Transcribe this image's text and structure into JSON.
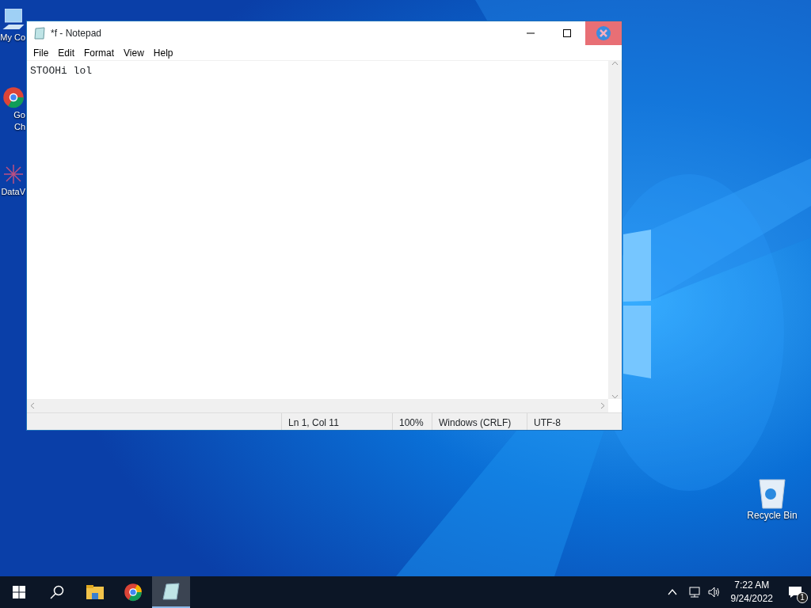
{
  "desktop_icons": [
    {
      "kind": "computer",
      "lines": [
        "My Co"
      ]
    },
    {
      "kind": "browser",
      "lines": [
        "Go",
        "Ch"
      ]
    },
    {
      "kind": "app",
      "lines": [
        "DataV"
      ]
    },
    {
      "kind": "recycle",
      "lines": [
        "Recycle Bin"
      ]
    }
  ],
  "window": {
    "title": "*f - Notepad",
    "menu": [
      "File",
      "Edit",
      "Format",
      "View",
      "Help"
    ],
    "text": "STOOHi lol",
    "status_bar": [
      "Ln 1, Col 11",
      "100%",
      "Windows (CRLF)",
      "UTF-8"
    ]
  },
  "taskbar": {
    "apps": [
      {
        "kind": "start",
        "selected": false
      },
      {
        "kind": "search",
        "selected": false
      },
      {
        "kind": "folder",
        "selected": false
      },
      {
        "kind": "browser",
        "selected": false
      },
      {
        "kind": "notepad",
        "selected": true
      }
    ],
    "time": "7:22 AM",
    "date": "9/24/2022",
    "notifications": "1"
  }
}
